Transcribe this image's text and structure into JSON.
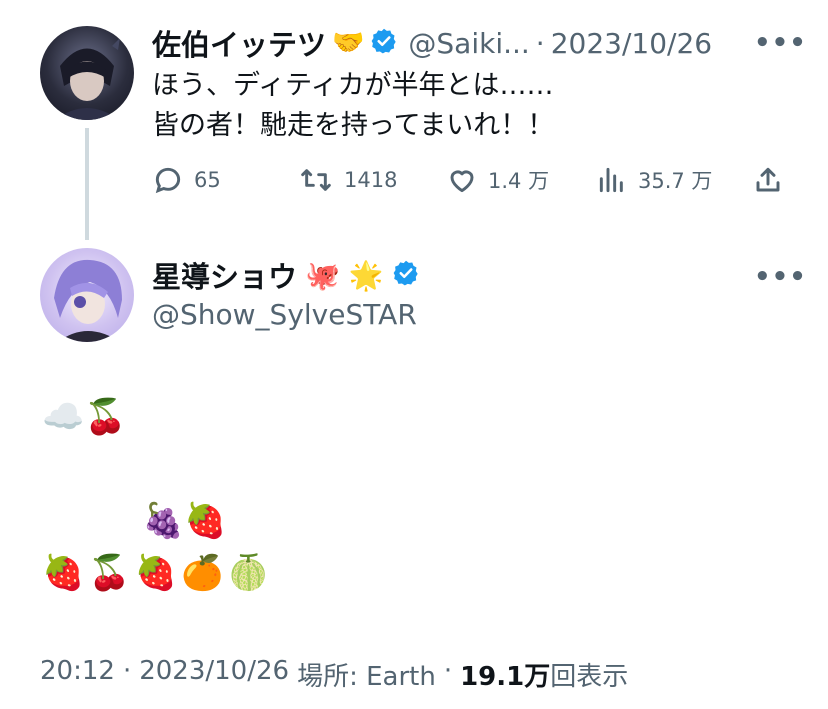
{
  "parent_tweet": {
    "display_name": "佐伯イッテツ",
    "name_emoji": "🤝",
    "handle": "@Saiki...",
    "separator": "·",
    "date": "2023/10/26",
    "text_line1": "ほう、ディティカが半年とは……",
    "text_line2": "皆の者！馳走を持ってまいれ！！",
    "replies": "65",
    "retweets": "1418",
    "likes": "1.4 万",
    "views": "35.7 万",
    "more": "•••"
  },
  "main_tweet": {
    "display_name": "星導ショウ",
    "name_emoji": "🐙 🌟",
    "handle": "@Show_SylveSTAR",
    "more": "•••",
    "line1": "☁️🍒",
    "line2": "🍇🍓",
    "line3": "🍓🍒🍓🍊🍈"
  },
  "footer": {
    "time": "20:12",
    "sep1": "·",
    "date": "2023/10/26",
    "location": "場所: Earth",
    "sep2": "·",
    "views_count": "19.1万",
    "views_label": "回表示"
  },
  "colors": {
    "verified": "#1d9bf0",
    "muted": "#536471",
    "text": "#0f1419",
    "thread_line": "#cfd9de"
  }
}
